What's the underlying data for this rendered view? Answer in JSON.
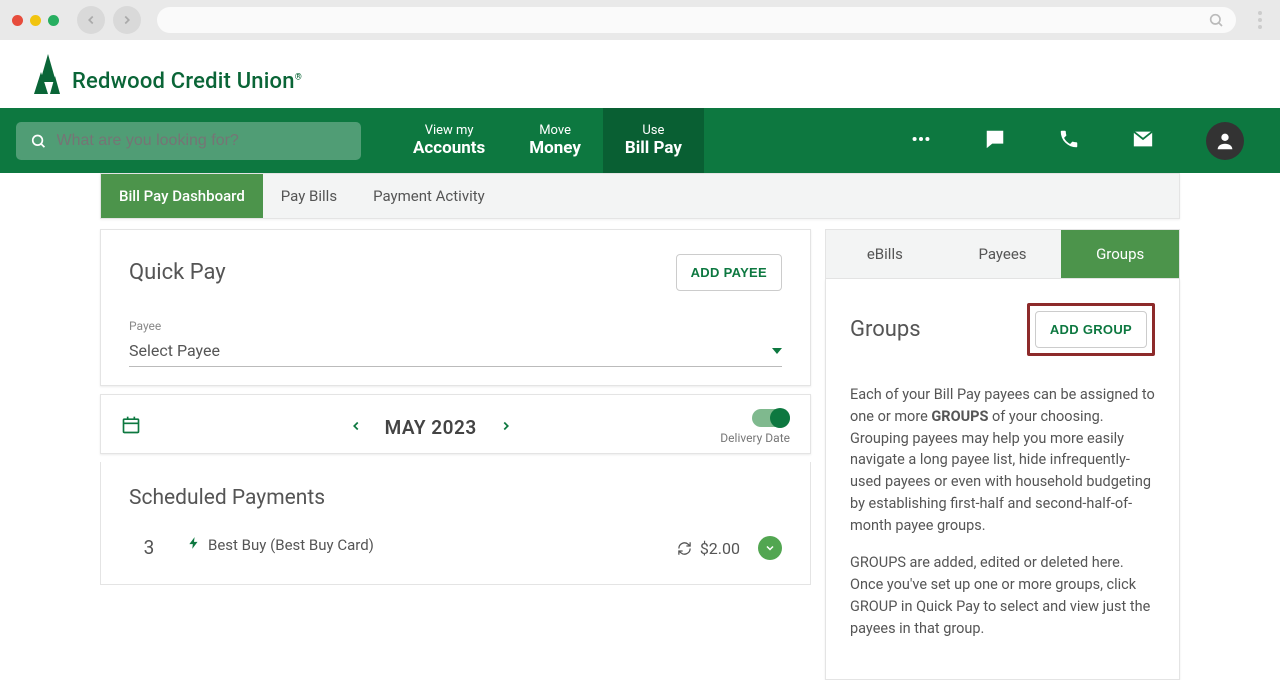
{
  "brand": {
    "name": "Redwood Credit Union"
  },
  "search": {
    "placeholder": "What are you looking for?"
  },
  "nav": [
    {
      "small": "View my",
      "large": "Accounts",
      "active": false
    },
    {
      "small": "Move",
      "large": "Money",
      "active": false
    },
    {
      "small": "Use",
      "large": "Bill Pay",
      "active": true
    }
  ],
  "subtabs": [
    "Bill Pay Dashboard",
    "Pay Bills",
    "Payment Activity"
  ],
  "quickpay": {
    "title": "Quick Pay",
    "add_payee": "ADD PAYEE",
    "payee_label": "Payee",
    "payee_value": "Select Payee"
  },
  "month_bar": {
    "month": "MAY 2023",
    "toggle_label": "Delivery Date"
  },
  "scheduled": {
    "title": "Scheduled Payments",
    "items": [
      {
        "day": "3",
        "payee": "Best Buy (Best Buy Card)",
        "amount": "$2.00"
      }
    ]
  },
  "right_tabs": [
    "eBills",
    "Payees",
    "Groups"
  ],
  "groups": {
    "title": "Groups",
    "add_group": "ADD GROUP",
    "para1_pre": "Each of your Bill Pay payees can be assigned to one or more ",
    "para1_strong": "GROUPS",
    "para1_post": " of your choosing. Grouping payees may help you more easily navigate a long payee list, hide infrequently-used payees or even with household budgeting by establishing first-half and second-half-of-month payee groups.",
    "para2": "GROUPS are added, edited or deleted here. Once you've set up one or more groups, click GROUP in Quick Pay to select and view just the payees in that group."
  }
}
